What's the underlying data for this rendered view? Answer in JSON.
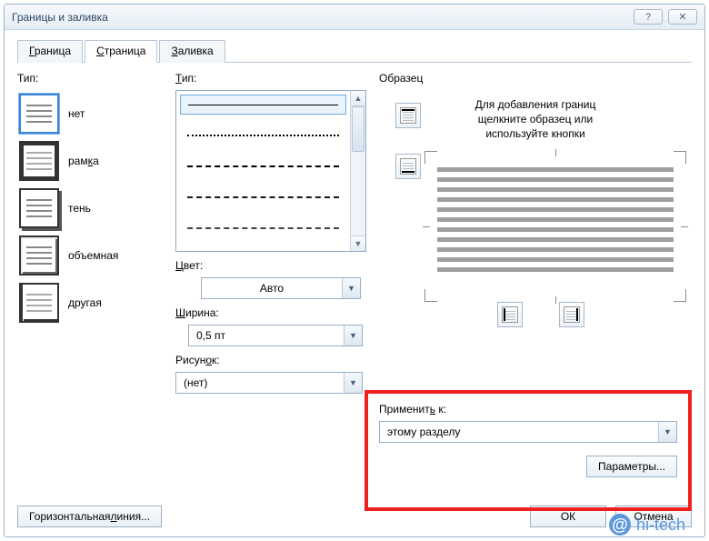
{
  "window": {
    "title": "Границы и заливка",
    "help": "?",
    "close": "✕"
  },
  "tabs": [
    "Граница",
    "Страница",
    "Заливка"
  ],
  "active_tab": 1,
  "left": {
    "label": "Тип:",
    "options": [
      {
        "label": "нет"
      },
      {
        "label": "рамка"
      },
      {
        "label": "тень"
      },
      {
        "label": "объемная"
      },
      {
        "label": "другая"
      }
    ],
    "selected": 0
  },
  "mid": {
    "style_label": "Тип:",
    "color_label": "Цвет:",
    "color_value": "Авто",
    "width_label": "Ширина:",
    "width_value": "0,5 пт",
    "picture_label": "Рисунок:",
    "picture_value": "(нет)"
  },
  "right": {
    "sample_label": "Образец",
    "hint_line1": "Для добавления границ",
    "hint_line2": "щелкните образец или",
    "hint_line3": "используйте кнопки",
    "apply_label": "Применить к:",
    "apply_value": "этому разделу",
    "params_button": "Параметры..."
  },
  "footer": {
    "hline": "Горизонтальная линия...",
    "ok": "ОК",
    "cancel": "Отмена"
  },
  "watermark": "hi-tech"
}
